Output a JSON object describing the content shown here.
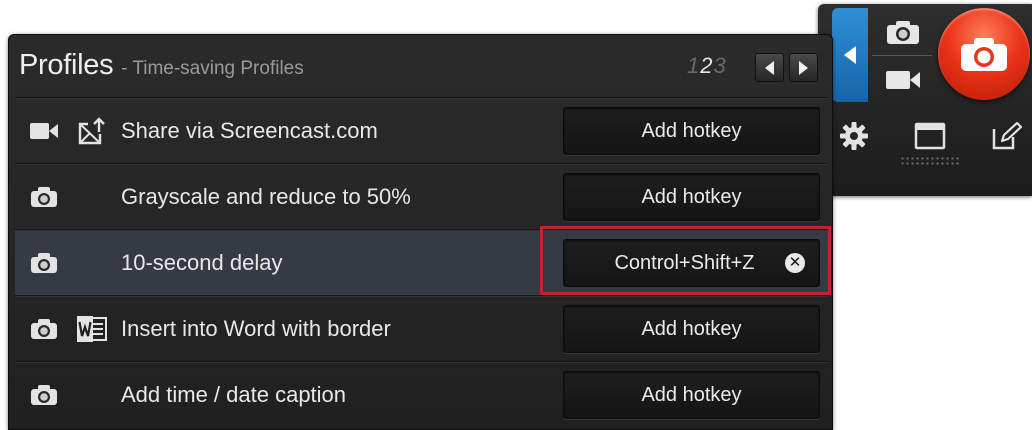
{
  "panel": {
    "title": "Profiles",
    "subtitle": "- Time-saving Profiles",
    "pages": [
      "1",
      "2",
      "3"
    ],
    "active_page": "2"
  },
  "profiles": [
    {
      "label": "Share via Screencast.com",
      "icon_primary": "video-camera-icon",
      "icon_secondary": "screencast-share-icon",
      "hotkey": "Add hotkey"
    },
    {
      "label": "Grayscale and reduce to 50%",
      "icon_primary": "camera-icon",
      "icon_secondary": "",
      "hotkey": "Add hotkey"
    },
    {
      "label": "10-second delay",
      "icon_primary": "camera-icon",
      "icon_secondary": "",
      "hotkey": "Control+Shift+Z",
      "selected": true
    },
    {
      "label": "Insert into Word with border",
      "icon_primary": "camera-icon",
      "icon_secondary": "word-icon",
      "hotkey": "Add hotkey"
    },
    {
      "label": "Add time / date caption",
      "icon_primary": "camera-icon",
      "icon_secondary": "",
      "hotkey": "Add hotkey"
    }
  ],
  "clear_glyph": "✕",
  "colors": {
    "panel_bg": "#262626",
    "selected_row": "#353a45",
    "capture_button": "#ec3418",
    "mode_toggle": "#1f7ac2",
    "highlight": "#c0242c"
  }
}
